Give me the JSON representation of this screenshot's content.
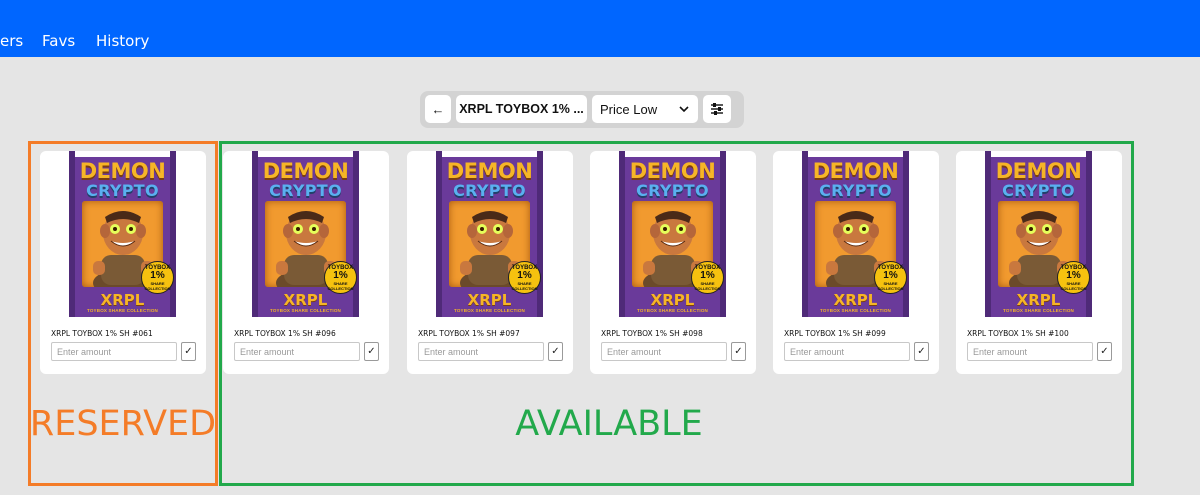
{
  "nav": {
    "items": [
      {
        "label": "ers"
      },
      {
        "label": "Favs"
      },
      {
        "label": "History"
      }
    ]
  },
  "toolbar": {
    "back_icon": "←",
    "collection_label": "XRPL TOYBOX 1% ...",
    "sort_value": "Price Low",
    "sort_icon": "chevron-down-icon",
    "filter_icon": "sliders-icon"
  },
  "card_art": {
    "line1": "DEMON",
    "line2": "CRYPTO",
    "seal_top": "TOYBOX",
    "seal_pct": "1%",
    "seal_bottom": "SHARE COLLECTION",
    "brand": "XRPL",
    "collection": "TOYBOX SHARE COLLECTION"
  },
  "cards": [
    {
      "name": "XRPL TOYBOX 1% SH #061",
      "placeholder": "Enter amount",
      "confirm": "✓"
    },
    {
      "name": "XRPL TOYBOX 1% SH #096",
      "placeholder": "Enter amount",
      "confirm": "✓"
    },
    {
      "name": "XRPL TOYBOX 1% SH #097",
      "placeholder": "Enter amount",
      "confirm": "✓"
    },
    {
      "name": "XRPL TOYBOX 1% SH #098",
      "placeholder": "Enter amount",
      "confirm": "✓"
    },
    {
      "name": "XRPL TOYBOX 1% SH #099",
      "placeholder": "Enter amount",
      "confirm": "✓"
    },
    {
      "name": "XRPL TOYBOX 1% SH #100",
      "placeholder": "Enter amount",
      "confirm": "✓"
    }
  ],
  "annotations": {
    "reserved": "RESERVED",
    "available": "AVAILABLE",
    "reserved_color": "#f47c28",
    "available_color": "#22a94b"
  },
  "colors": {
    "header": "#0066ff",
    "background": "#e5e5e5"
  }
}
